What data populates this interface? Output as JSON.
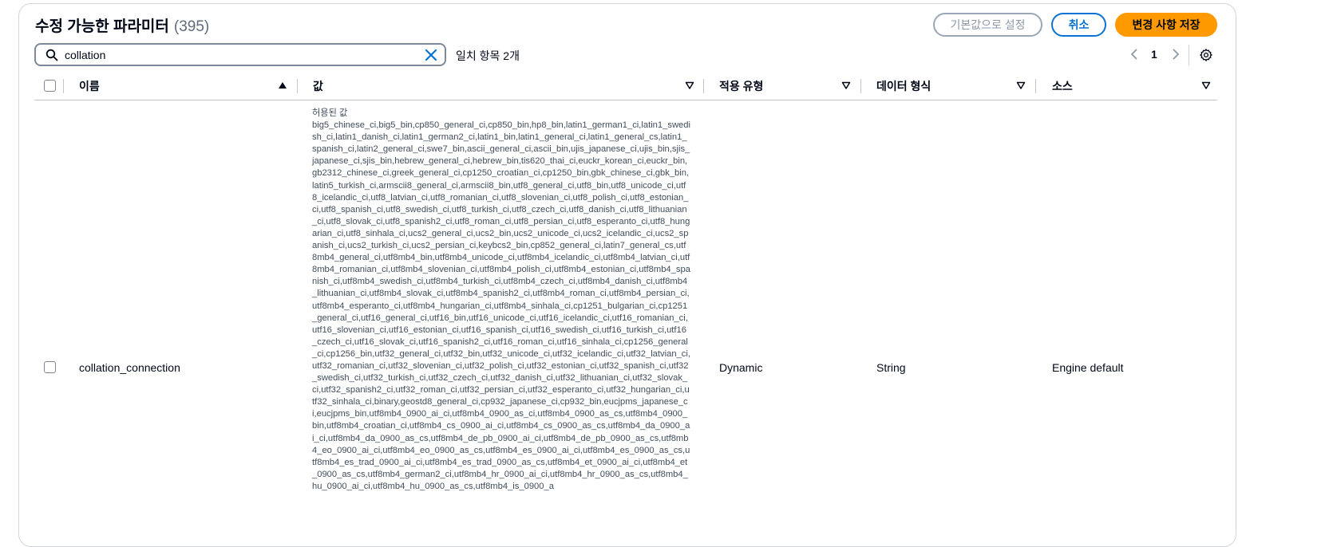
{
  "header": {
    "title": "수정 가능한 파라미터",
    "count": "(395)",
    "reset_label": "기본값으로 설정",
    "cancel_label": "취소",
    "save_label": "변경 사항 저장"
  },
  "search": {
    "value": "collation",
    "placeholder": "",
    "match_text": "일치 항목 2개"
  },
  "pagination": {
    "current_page": "1"
  },
  "columns": {
    "name": "이름",
    "value": "값",
    "apply_type": "적용 유형",
    "data_type": "데이터 형식",
    "source": "소스"
  },
  "rows": [
    {
      "name": "collation_connection",
      "allowed_label": "허용된 값",
      "allowed_values": "big5_chinese_ci,big5_bin,cp850_general_ci,cp850_bin,hp8_bin,latin1_german1_ci,latin1_swedish_ci,latin1_danish_ci,latin1_german2_ci,latin1_bin,latin1_general_ci,latin1_general_cs,latin1_spanish_ci,latin2_general_ci,swe7_bin,ascii_general_ci,ascii_bin,ujis_japanese_ci,ujis_bin,sjis_japanese_ci,sjis_bin,hebrew_general_ci,hebrew_bin,tis620_thai_ci,euckr_korean_ci,euckr_bin,gb2312_chinese_ci,greek_general_ci,cp1250_croatian_ci,cp1250_bin,gbk_chinese_ci,gbk_bin,latin5_turkish_ci,armscii8_general_ci,armscii8_bin,utf8_general_ci,utf8_bin,utf8_unicode_ci,utf8_icelandic_ci,utf8_latvian_ci,utf8_romanian_ci,utf8_slovenian_ci,utf8_polish_ci,utf8_estonian_ci,utf8_spanish_ci,utf8_swedish_ci,utf8_turkish_ci,utf8_czech_ci,utf8_danish_ci,utf8_lithuanian_ci,utf8_slovak_ci,utf8_spanish2_ci,utf8_roman_ci,utf8_persian_ci,utf8_esperanto_ci,utf8_hungarian_ci,utf8_sinhala_ci,ucs2_general_ci,ucs2_bin,ucs2_unicode_ci,ucs2_icelandic_ci,ucs2_spanish_ci,ucs2_turkish_ci,ucs2_persian_ci,keybcs2_bin,cp852_general_ci,latin7_general_cs,utf8mb4_general_ci,utf8mb4_bin,utf8mb4_unicode_ci,utf8mb4_icelandic_ci,utf8mb4_latvian_ci,utf8mb4_romanian_ci,utf8mb4_slovenian_ci,utf8mb4_polish_ci,utf8mb4_estonian_ci,utf8mb4_spanish_ci,utf8mb4_swedish_ci,utf8mb4_turkish_ci,utf8mb4_czech_ci,utf8mb4_danish_ci,utf8mb4_lithuanian_ci,utf8mb4_slovak_ci,utf8mb4_spanish2_ci,utf8mb4_roman_ci,utf8mb4_persian_ci,utf8mb4_esperanto_ci,utf8mb4_hungarian_ci,utf8mb4_sinhala_ci,cp1251_bulgarian_ci,cp1251_general_ci,utf16_general_ci,utf16_bin,utf16_unicode_ci,utf16_icelandic_ci,utf16_romanian_ci,utf16_slovenian_ci,utf16_estonian_ci,utf16_spanish_ci,utf16_swedish_ci,utf16_turkish_ci,utf16_czech_ci,utf16_slovak_ci,utf16_spanish2_ci,utf16_roman_ci,utf16_sinhala_ci,cp1256_general_ci,cp1256_bin,utf32_general_ci,utf32_bin,utf32_unicode_ci,utf32_icelandic_ci,utf32_latvian_ci,utf32_romanian_ci,utf32_slovenian_ci,utf32_polish_ci,utf32_estonian_ci,utf32_spanish_ci,utf32_swedish_ci,utf32_turkish_ci,utf32_czech_ci,utf32_danish_ci,utf32_lithuanian_ci,utf32_slovak_ci,utf32_spanish2_ci,utf32_roman_ci,utf32_persian_ci,utf32_esperanto_ci,utf32_hungarian_ci,utf32_sinhala_ci,binary,geostd8_general_ci,cp932_japanese_ci,cp932_bin,eucjpms_japanese_ci,eucjpms_bin,utf8mb4_0900_ai_ci,utf8mb4_0900_as_ci,utf8mb4_0900_as_cs,utf8mb4_0900_bin,utf8mb4_croatian_ci,utf8mb4_cs_0900_ai_ci,utf8mb4_cs_0900_as_cs,utf8mb4_da_0900_ai_ci,utf8mb4_da_0900_as_cs,utf8mb4_de_pb_0900_ai_ci,utf8mb4_de_pb_0900_as_cs,utf8mb4_eo_0900_ai_ci,utf8mb4_eo_0900_as_cs,utf8mb4_es_0900_ai_ci,utf8mb4_es_0900_as_cs,utf8mb4_es_trad_0900_ai_ci,utf8mb4_es_trad_0900_as_cs,utf8mb4_et_0900_ai_ci,utf8mb4_et_0900_as_cs,utf8mb4_german2_ci,utf8mb4_hr_0900_ai_ci,utf8mb4_hr_0900_as_cs,utf8mb4_hu_0900_ai_ci,utf8mb4_hu_0900_as_cs,utf8mb4_is_0900_a",
      "apply_type": "Dynamic",
      "data_type": "String",
      "source": "Engine default"
    }
  ],
  "colors": {
    "accent": "#0972d3",
    "primary": "#ff9900",
    "border": "#7d8998"
  }
}
